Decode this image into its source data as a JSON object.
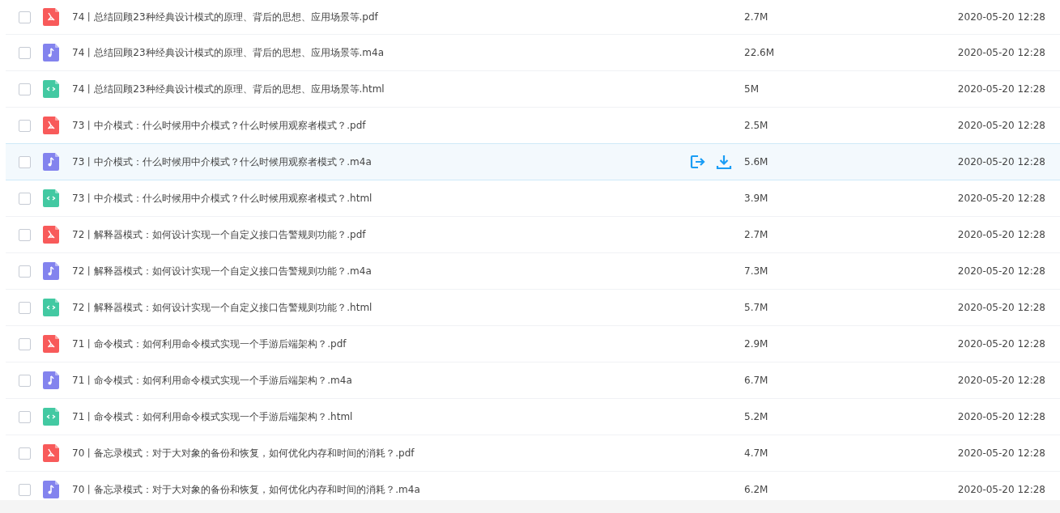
{
  "files": [
    {
      "kind": "pdf",
      "name": "74丨总结回顾23种经典设计模式的原理、背后的思想、应用场景等.pdf",
      "size": "2.7M",
      "date": "2020-05-20 12:28",
      "checked": false,
      "highlighted": false
    },
    {
      "kind": "audio",
      "name": "74丨总结回顾23种经典设计模式的原理、背后的思想、应用场景等.m4a",
      "size": "22.6M",
      "date": "2020-05-20 12:28",
      "checked": false,
      "highlighted": false
    },
    {
      "kind": "html",
      "name": "74丨总结回顾23种经典设计模式的原理、背后的思想、应用场景等.html",
      "size": "5M",
      "date": "2020-05-20 12:28",
      "checked": false,
      "highlighted": false
    },
    {
      "kind": "pdf",
      "name": "73丨中介模式：什么时候用中介模式？什么时候用观察者模式？.pdf",
      "size": "2.5M",
      "date": "2020-05-20 12:28",
      "checked": false,
      "highlighted": false
    },
    {
      "kind": "audio",
      "name": "73丨中介模式：什么时候用中介模式？什么时候用观察者模式？.m4a",
      "size": "5.6M",
      "date": "2020-05-20 12:28",
      "checked": false,
      "highlighted": true
    },
    {
      "kind": "html",
      "name": "73丨中介模式：什么时候用中介模式？什么时候用观察者模式？.html",
      "size": "3.9M",
      "date": "2020-05-20 12:28",
      "checked": false,
      "highlighted": false
    },
    {
      "kind": "pdf",
      "name": "72丨解释器模式：如何设计实现一个自定义接口告警规则功能？.pdf",
      "size": "2.7M",
      "date": "2020-05-20 12:28",
      "checked": false,
      "highlighted": false
    },
    {
      "kind": "audio",
      "name": "72丨解释器模式：如何设计实现一个自定义接口告警规则功能？.m4a",
      "size": "7.3M",
      "date": "2020-05-20 12:28",
      "checked": false,
      "highlighted": false
    },
    {
      "kind": "html",
      "name": "72丨解释器模式：如何设计实现一个自定义接口告警规则功能？.html",
      "size": "5.7M",
      "date": "2020-05-20 12:28",
      "checked": false,
      "highlighted": false
    },
    {
      "kind": "pdf",
      "name": "71丨命令模式：如何利用命令模式实现一个手游后端架构？.pdf",
      "size": "2.9M",
      "date": "2020-05-20 12:28",
      "checked": false,
      "highlighted": false
    },
    {
      "kind": "audio",
      "name": "71丨命令模式：如何利用命令模式实现一个手游后端架构？.m4a",
      "size": "6.7M",
      "date": "2020-05-20 12:28",
      "checked": false,
      "highlighted": false
    },
    {
      "kind": "html",
      "name": "71丨命令模式：如何利用命令模式实现一个手游后端架构？.html",
      "size": "5.2M",
      "date": "2020-05-20 12:28",
      "checked": false,
      "highlighted": false
    },
    {
      "kind": "pdf",
      "name": "70丨备忘录模式：对于大对象的备份和恢复，如何优化内存和时间的消耗？.pdf",
      "size": "4.7M",
      "date": "2020-05-20 12:28",
      "checked": false,
      "highlighted": false
    },
    {
      "kind": "audio",
      "name": "70丨备忘录模式：对于大对象的备份和恢复，如何优化内存和时间的消耗？.m4a",
      "size": "6.2M",
      "date": "2020-05-20 12:28",
      "checked": false,
      "highlighted": false
    }
  ]
}
